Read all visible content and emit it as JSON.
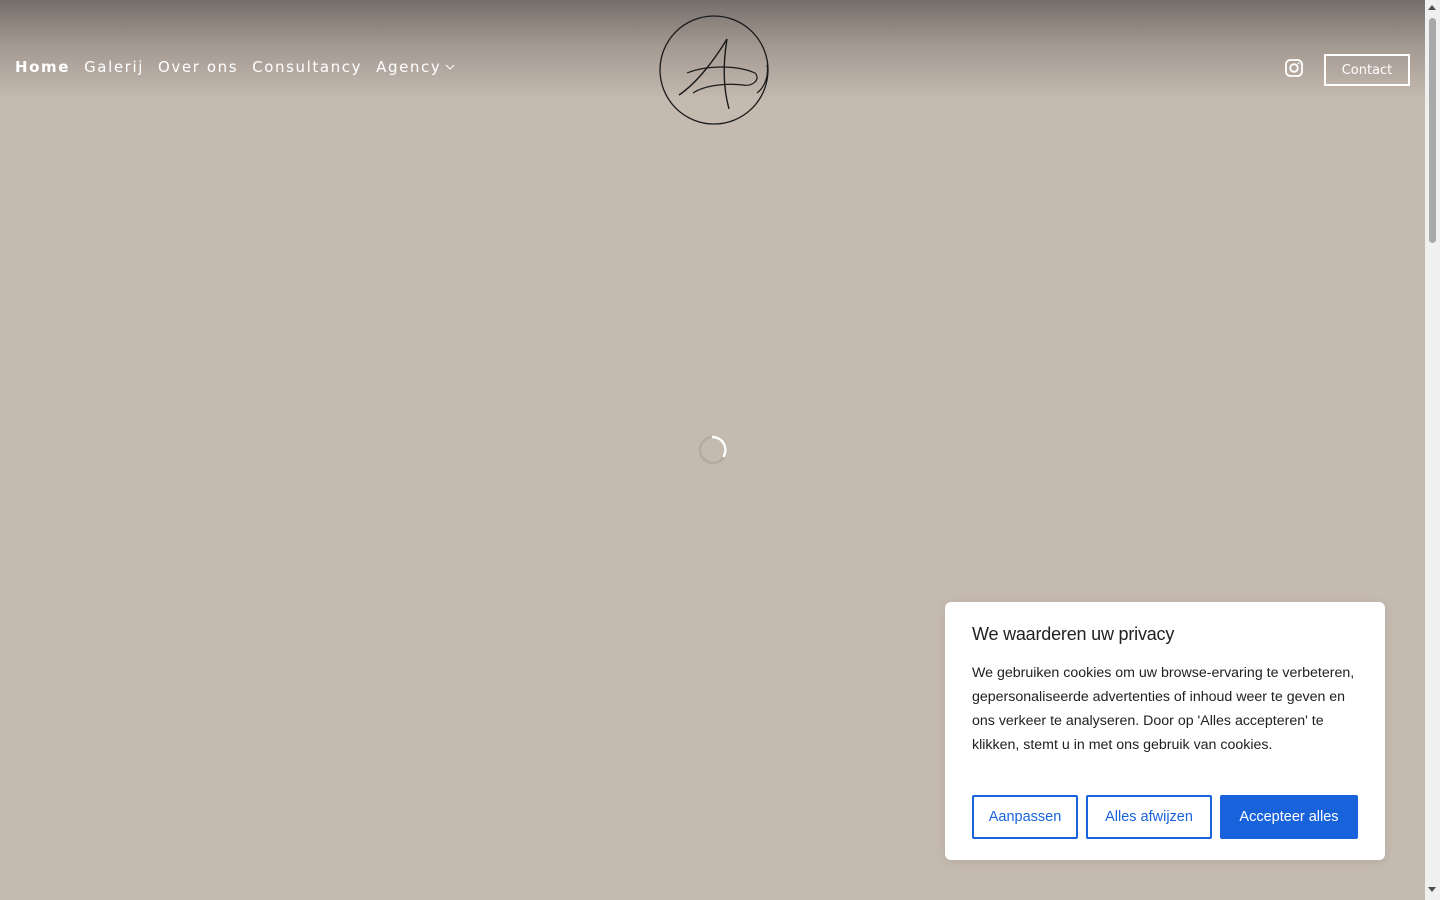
{
  "nav": {
    "items": [
      {
        "label": "Home",
        "active": true
      },
      {
        "label": "Galerij",
        "active": false
      },
      {
        "label": "Over ons",
        "active": false
      },
      {
        "label": "Consultancy",
        "active": false
      },
      {
        "label": "Agency",
        "active": false,
        "has_dropdown": true
      }
    ]
  },
  "logo": {
    "icon": "monogram-a-logo"
  },
  "header": {
    "instagram_icon": "instagram-icon",
    "contact_label": "Contact"
  },
  "loading": {
    "icon": "spinner-icon"
  },
  "cookie_banner": {
    "title": "We waarderen uw privacy",
    "text": "We gebruiken cookies om uw browse-ervaring te verbeteren, gepersonaliseerde advertenties of inhoud weer te geven en ons verkeer te analyseren. Door op 'Alles accepteren' te klikken, stemt u in met ons gebruik van cookies.",
    "customize_label": "Aanpassen",
    "reject_label": "Alles afwijzen",
    "accept_label": "Accepteer alles"
  },
  "colors": {
    "background": "#c5bab0",
    "accent": "#1863dc"
  }
}
